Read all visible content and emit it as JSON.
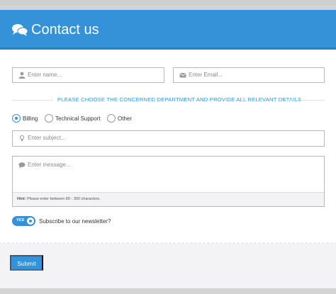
{
  "header": {
    "title": "Contact us",
    "icon": "chat-bubbles-icon"
  },
  "fields": {
    "name_placeholder": "Enter name...",
    "email_placeholder": "Enter Email...",
    "subject_placeholder": "Enter subject...",
    "message_placeholder": "Enter message..."
  },
  "department": {
    "heading": "PLEASE CHOOSE THE CONCERNED DEPARTMENT AND PROVIDE ALL RELEVANT DETAILS",
    "options": [
      "Billing",
      "Technical Support",
      "Other"
    ],
    "selected": "Billing"
  },
  "hint": {
    "label": "Hint:",
    "text": "Please enter between 80 - 300 characters."
  },
  "newsletter": {
    "toggle_label": "YES",
    "label": "Subscribe to our newsletter?",
    "checked": true
  },
  "submit_label": "Submit",
  "colors": {
    "accent": "#3592d9",
    "footer_bg": "#f3f3f6"
  }
}
